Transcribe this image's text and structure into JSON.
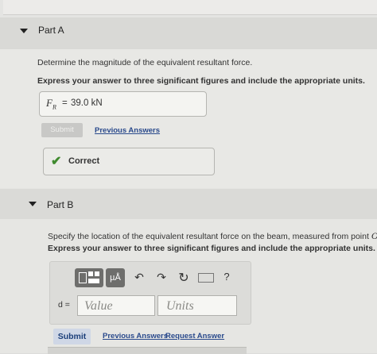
{
  "partA": {
    "title": "Part A",
    "question": "Determine the magnitude of the equivalent resultant force.",
    "instruction": "Express your answer to three significant figures and include the appropriate units.",
    "answer_label": "F",
    "answer_sub": "R",
    "answer_eq": "=",
    "answer_value": "39.0 kN",
    "submit_label": "Submit",
    "previous_answers": "Previous Answers",
    "feedback": "Correct"
  },
  "partB": {
    "title": "Part B",
    "question_pre": "Specify the location of the equivalent resultant force on the beam, measured from point ",
    "question_point": "O",
    "question_post": ".",
    "instruction": "Express your answer to three significant figures and include the appropriate units.",
    "toolbar": {
      "units_button": "µÅ",
      "help": "?"
    },
    "var_label": "d =",
    "value_placeholder": "Value",
    "units_placeholder": "Units",
    "submit_label": "Submit",
    "previous_answers": "Previous Answers",
    "request_answer": "Request Answer"
  },
  "colors": {
    "link": "#2a4a8c",
    "correct": "#3f8a2e",
    "submit_bg": "#cfd7e6"
  },
  "icons": [
    "caret-down-icon",
    "checkmark-icon",
    "templates-icon",
    "undo-icon",
    "redo-icon",
    "reset-icon",
    "keyboard-icon",
    "help-icon"
  ]
}
